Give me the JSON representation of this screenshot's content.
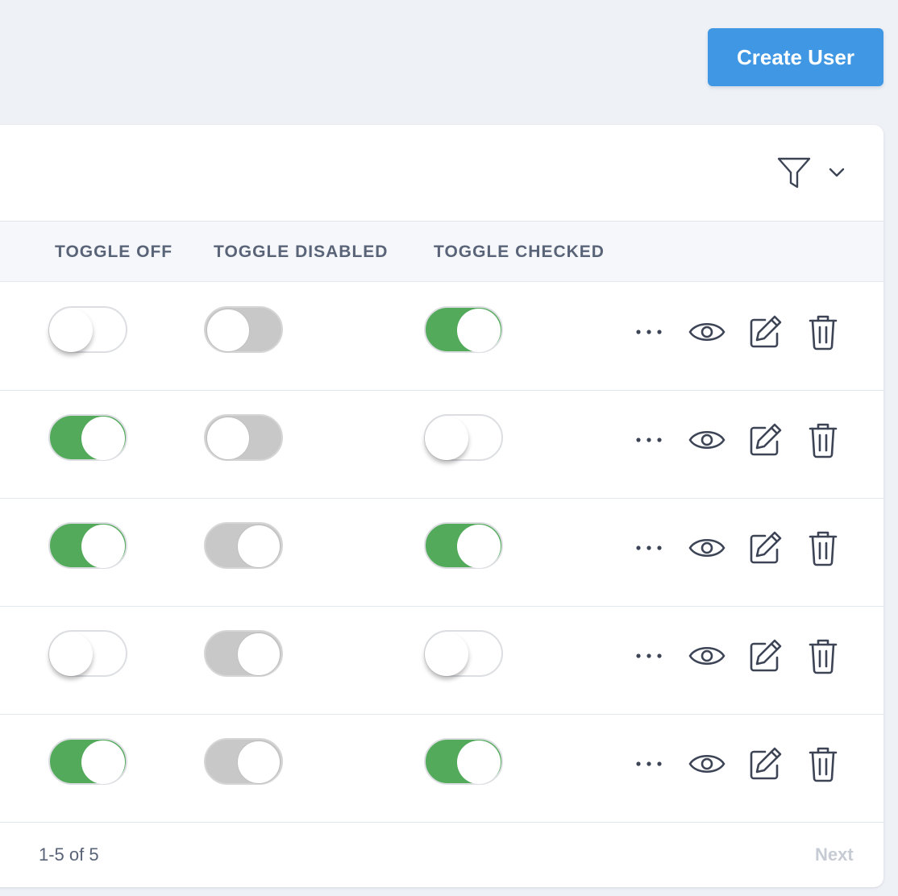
{
  "header": {
    "create_button_label": "Create User"
  },
  "table": {
    "columns": [
      "TOGGLE OFF",
      "TOGGLE DISABLED",
      "TOGGLE CHECKED"
    ],
    "rows": [
      {
        "toggle_off": false,
        "toggle_disabled": false,
        "toggle_checked": true
      },
      {
        "toggle_off": true,
        "toggle_disabled": false,
        "toggle_checked": false
      },
      {
        "toggle_off": true,
        "toggle_disabled": true,
        "toggle_checked": true
      },
      {
        "toggle_off": false,
        "toggle_disabled": true,
        "toggle_checked": false
      },
      {
        "toggle_off": true,
        "toggle_disabled": true,
        "toggle_checked": true
      }
    ],
    "row_actions": [
      "more-icon",
      "view-icon",
      "edit-icon",
      "delete-icon"
    ]
  },
  "filter": {
    "icons": [
      "filter-icon",
      "chevron-down-icon"
    ]
  },
  "footer": {
    "range_text": "1-5 of 5",
    "next_label": "Next"
  },
  "colors": {
    "accent": "#4098e4",
    "toggle_on": "#52aa5a",
    "toggle_disabled": "#c8c8c8",
    "text_muted": "#5a6478"
  }
}
